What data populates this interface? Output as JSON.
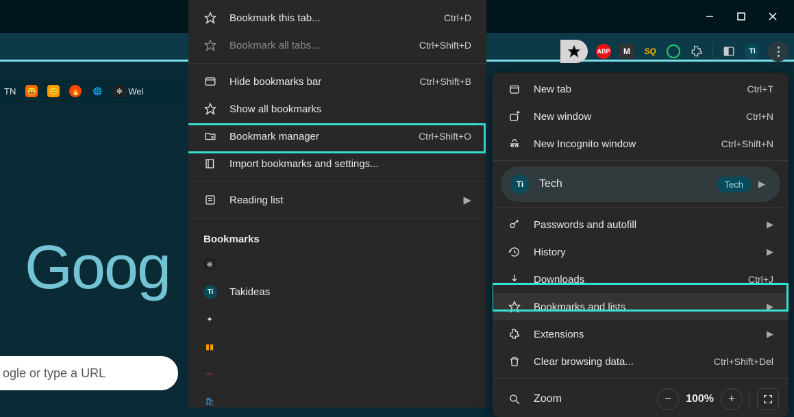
{
  "window": {
    "title": ""
  },
  "bookmarks_bar": {
    "items": [
      "TN",
      "",
      "",
      "",
      "",
      "",
      "Wel"
    ]
  },
  "page": {
    "logo_fragment": "Goog",
    "search_placeholder": "ogle or type a URL"
  },
  "submenu": {
    "items": [
      {
        "label": "Bookmark this tab...",
        "shortcut": "Ctrl+D",
        "dim": false,
        "icon": "star"
      },
      {
        "label": "Bookmark all tabs...",
        "shortcut": "Ctrl+Shift+D",
        "dim": true,
        "icon": "star"
      }
    ],
    "items2": [
      {
        "label": "Hide bookmarks bar",
        "shortcut": "Ctrl+Shift+B",
        "icon": "hide"
      },
      {
        "label": "Show all bookmarks",
        "shortcut": "",
        "icon": "star"
      },
      {
        "label": "Bookmark manager",
        "shortcut": "Ctrl+Shift+O",
        "icon": "folder",
        "highlighted": true
      },
      {
        "label": "Import bookmarks and settings...",
        "shortcut": "",
        "icon": "book"
      }
    ],
    "reading": {
      "label": "Reading list",
      "icon": "list"
    },
    "heading": "Bookmarks",
    "bookmarks": [
      {
        "label": "",
        "icon": "sparkle-dark"
      },
      {
        "label": "Takideas",
        "icon": "ti"
      },
      {
        "label": "",
        "icon": "sparkle"
      },
      {
        "label": "",
        "icon": "bars"
      },
      {
        "label": "",
        "icon": "trend"
      },
      {
        "label": "",
        "icon": "bag"
      }
    ]
  },
  "mainmenu": {
    "group1": [
      {
        "label": "New tab",
        "shortcut": "Ctrl+T",
        "icon": "newtab"
      },
      {
        "label": "New window",
        "shortcut": "Ctrl+N",
        "icon": "newwindow"
      },
      {
        "label": "New Incognito window",
        "shortcut": "Ctrl+Shift+N",
        "icon": "incognito"
      }
    ],
    "profile": {
      "label": "Tech",
      "badge": "Tech"
    },
    "group2": [
      {
        "label": "Passwords and autofill",
        "icon": "key",
        "chev": true
      },
      {
        "label": "History",
        "icon": "history",
        "chev": true
      },
      {
        "label": "Downloads",
        "icon": "download",
        "shortcut": "Ctrl+J"
      },
      {
        "label": "Bookmarks and lists",
        "icon": "star",
        "chev": true,
        "selected": true,
        "highlighted": true
      },
      {
        "label": "Extensions",
        "icon": "puzzle",
        "chev": true
      },
      {
        "label": "Clear browsing data...",
        "icon": "trash",
        "shortcut": "Ctrl+Shift+Del"
      }
    ],
    "zoom": {
      "label": "Zoom",
      "value": "100%"
    }
  }
}
